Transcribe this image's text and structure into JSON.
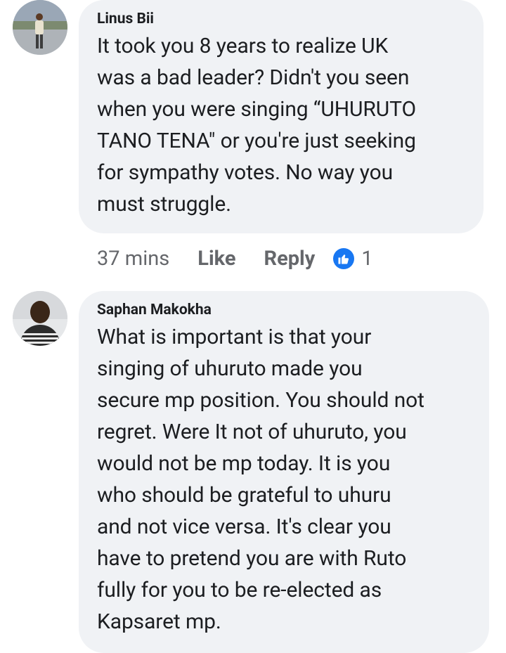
{
  "comments": [
    {
      "author": "Linus Bii",
      "text": "It took you 8 years to realize UK\nwas a bad leader? Didn't you seen\nwhen you were singing “UHURUTO\nTANO TENA\" or you're just seeking\nfor sympathy votes. No way you\nmust struggle.",
      "time": "37 mins",
      "like_label": "Like",
      "reply_label": "Reply",
      "reaction_icon": "thumbs-up-icon",
      "reaction_count": "1"
    },
    {
      "author": "Saphan Makokha",
      "text": "What is important is that your\nsinging of uhuruto made you\nsecure mp position. You should not\nregret. Were It not of uhuruto, you\nwould not be mp today. It is you\nwho should be grateful to uhuru\nand not vice versa. It's clear you\nhave to pretend you are with Ruto\nfully for you to be re-elected as\nKapsaret mp."
    }
  ],
  "colors": {
    "bubble_bg": "#f0f2f5",
    "text": "#1c1e21",
    "meta_text": "#65676b",
    "like_blue": "#1877f2"
  }
}
